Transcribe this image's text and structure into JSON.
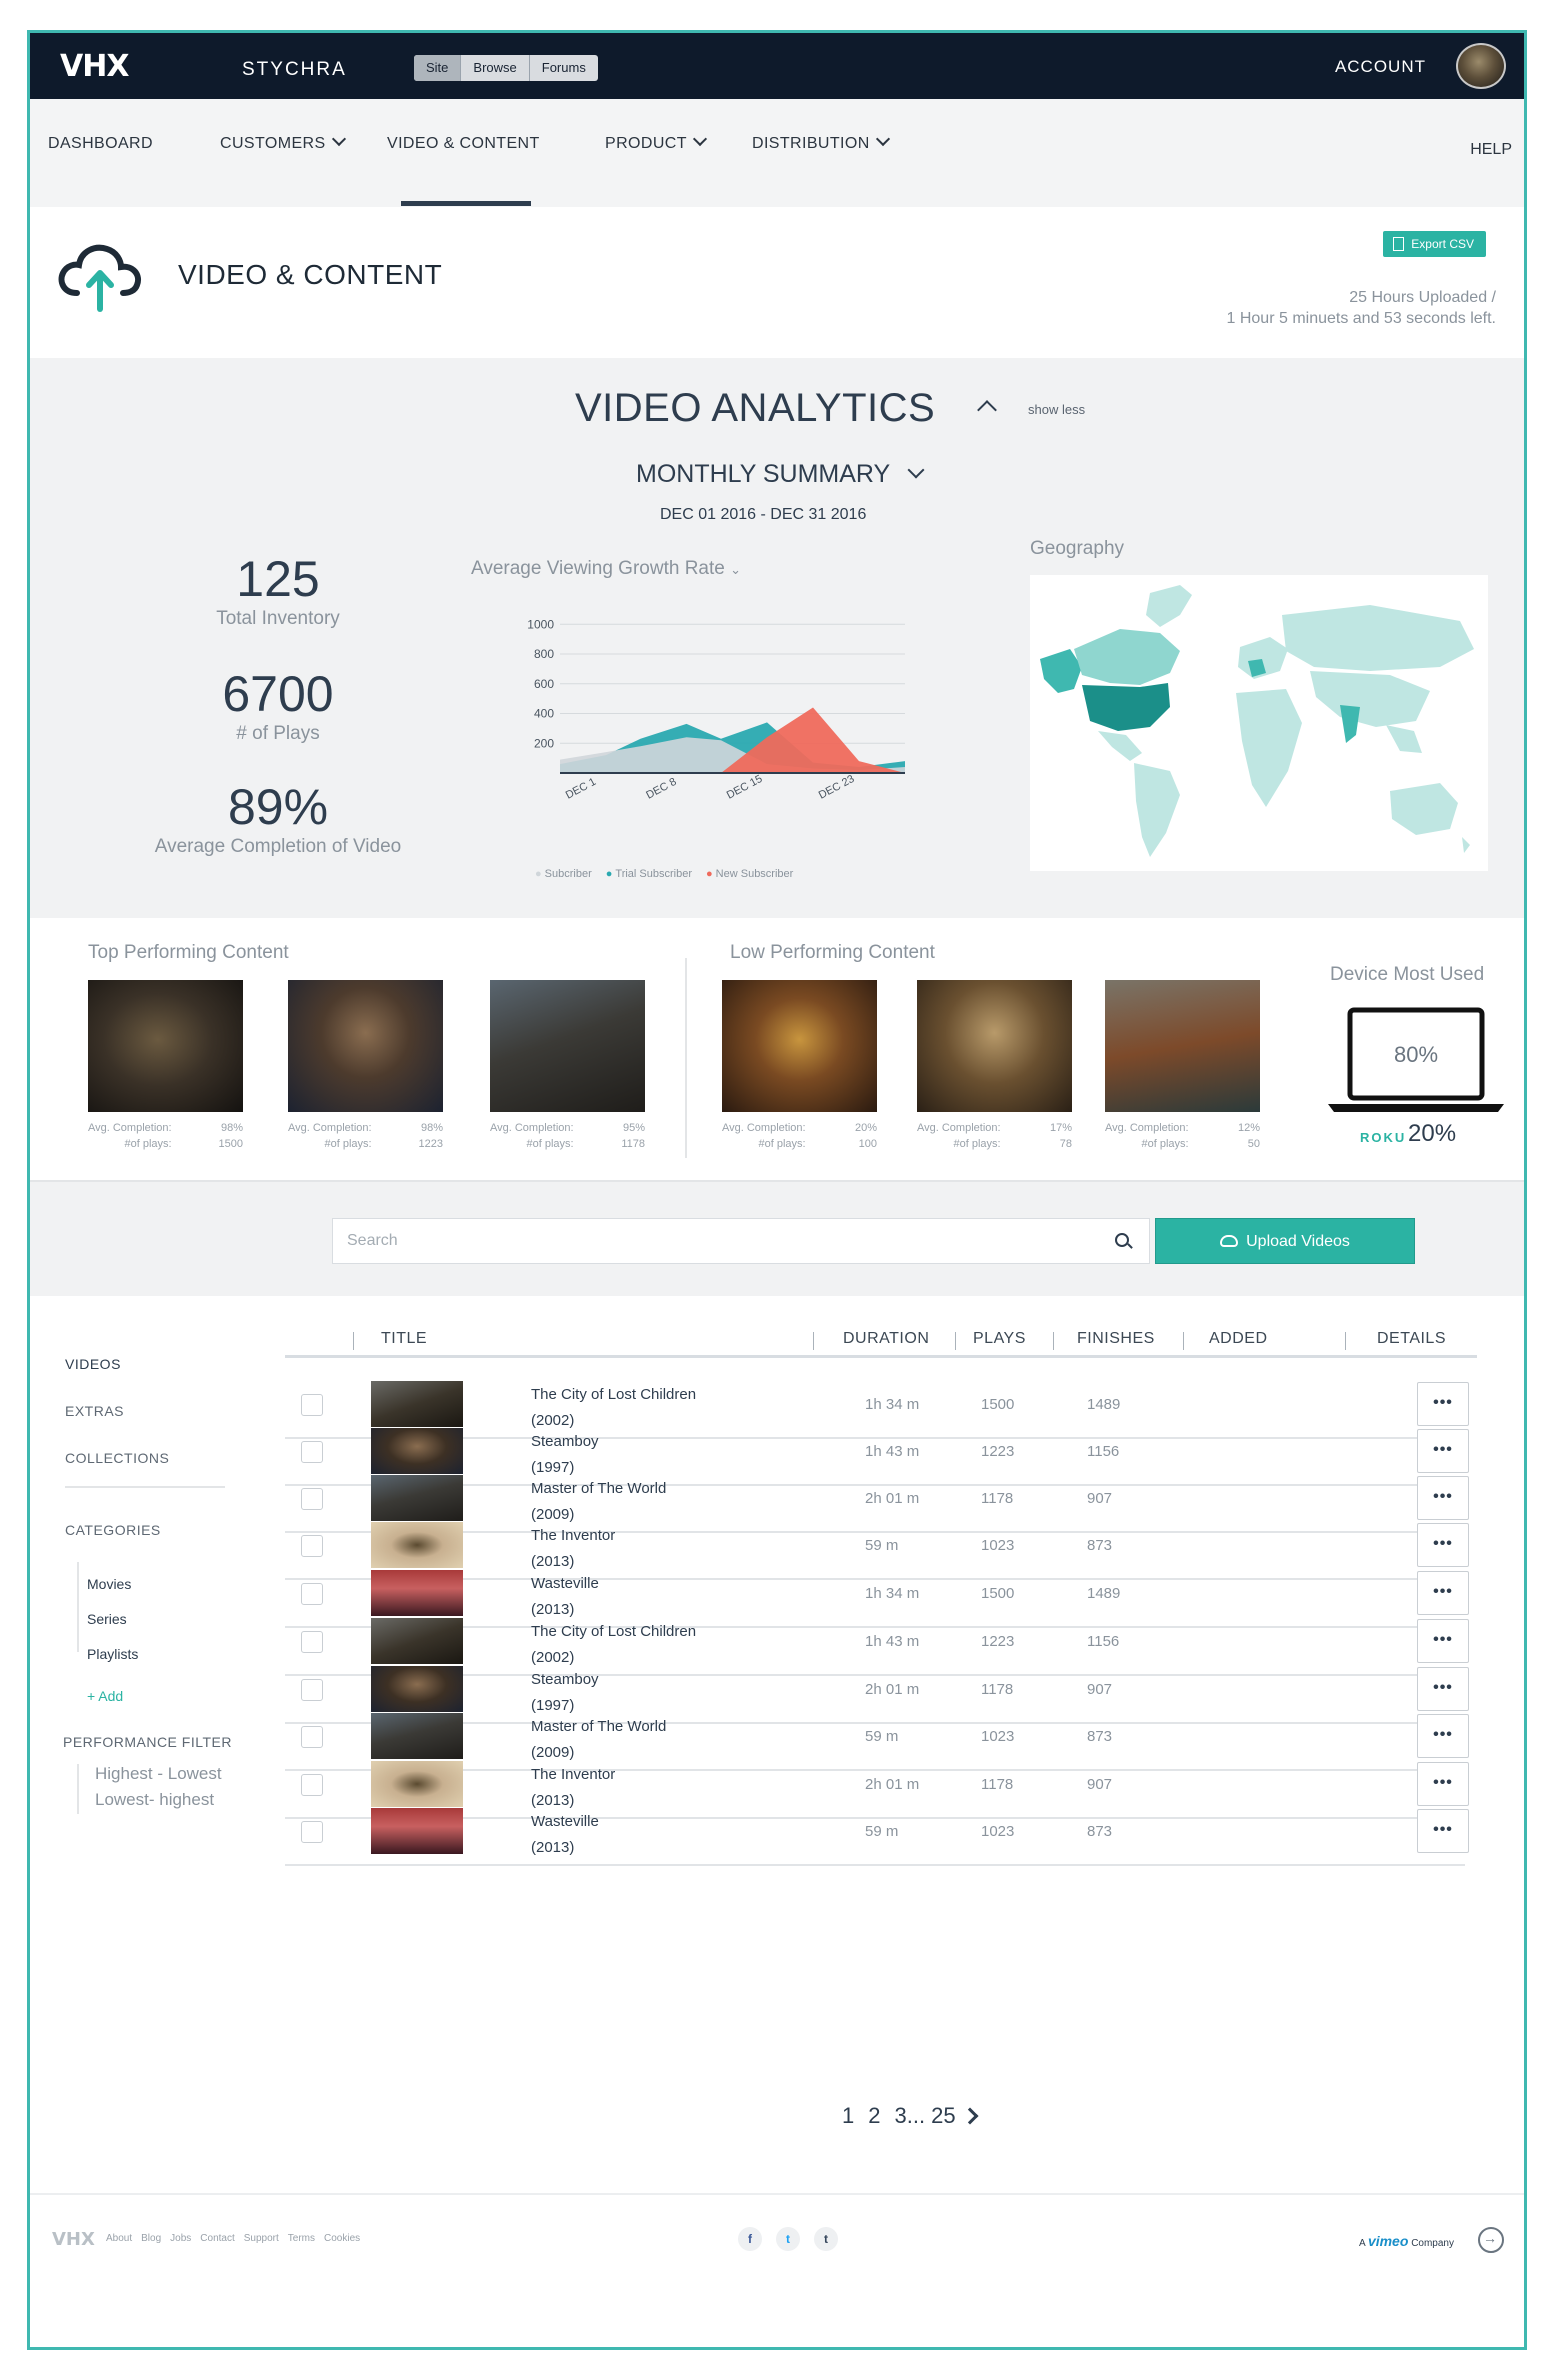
{
  "topbar": {
    "logo": "VHX",
    "site_name": "STYCHRA",
    "switcher": [
      "Site",
      "Browse",
      "Forums"
    ],
    "account": "ACCOUNT"
  },
  "nav": {
    "items": [
      {
        "label": "DASHBOARD"
      },
      {
        "label": "CUSTOMERS"
      },
      {
        "label": "VIDEO & CONTENT"
      },
      {
        "label": "PRODUCT"
      },
      {
        "label": "DISTRIBUTION"
      }
    ],
    "help": "HELP"
  },
  "header": {
    "title": "VIDEO & CONTENT",
    "export": "Export CSV",
    "upload_line1": "25 Hours Uploaded /",
    "upload_line2": "1 Hour  5 minuets and 53 seconds left."
  },
  "analytics": {
    "title": "VIDEO ANALYTICS",
    "show_less": "show less",
    "summary": "MONTHLY SUMMARY",
    "range": "DEC 01 2016 - DEC 31 2016",
    "stats": [
      {
        "value": "125",
        "label": "Total Inventory"
      },
      {
        "value": "6700",
        "label": "# of Plays"
      },
      {
        "value": "89%",
        "label": "Average Completion of Video"
      }
    ],
    "chart_title": "Average Viewing Growth Rate",
    "geo_title": "Geography"
  },
  "chart_data": {
    "type": "area",
    "title": "Average Viewing Growth Rate",
    "xlabel": "",
    "ylabel": "",
    "ylim": [
      0,
      1000
    ],
    "yticks": [
      1000,
      800,
      600,
      400,
      200
    ],
    "categories": [
      "DEC 1",
      "DEC 8",
      "DEC 15",
      "DEC 23"
    ],
    "x": [
      1,
      5,
      8,
      12,
      15,
      19,
      23,
      27,
      31
    ],
    "series": [
      {
        "name": "Subcriber",
        "color": "#d0d6da",
        "values": [
          90,
          140,
          180,
          240,
          220,
          60,
          30,
          20,
          40
        ]
      },
      {
        "name": "Trial Subscriber",
        "color": "#2aa9b0",
        "values": [
          60,
          120,
          230,
          330,
          230,
          340,
          70,
          40,
          80
        ]
      },
      {
        "name": "New Subscriber",
        "color": "#ef6a5c",
        "values": [
          0,
          0,
          0,
          0,
          0,
          240,
          440,
          80,
          0
        ]
      }
    ]
  },
  "top_performing": {
    "title": "Top Performing Content",
    "items": [
      {
        "completion": "98%",
        "plays": "1500"
      },
      {
        "completion": "98%",
        "plays": "1223"
      },
      {
        "completion": "95%",
        "plays": "1178"
      }
    ]
  },
  "low_performing": {
    "title": "Low Performing Content",
    "items": [
      {
        "completion": "20%",
        "plays": "100"
      },
      {
        "completion": "17%",
        "plays": "78"
      },
      {
        "completion": "12%",
        "plays": "50"
      }
    ]
  },
  "tile_labels": {
    "completion": "Avg. Completion:",
    "plays": "#of plays:"
  },
  "device": {
    "title": "Device Most Used",
    "laptop_pct": "80%",
    "roku": "ROKU",
    "roku_pct": "20%"
  },
  "search": {
    "placeholder": "Search",
    "upload": "Upload Videos"
  },
  "sidebar": {
    "videos": "VIDEOS",
    "extras": "EXTRAS",
    "collections": "COLLECTIONS",
    "categories": "CATEGORIES",
    "category_items": [
      "Movies",
      "Series",
      "Playlists"
    ],
    "add": "+ Add",
    "performance": "PERFORMANCE FILTER",
    "filters": [
      "Highest - Lowest",
      "Lowest- highest"
    ]
  },
  "table": {
    "headers": {
      "title": "TITLE",
      "duration": "DURATION",
      "plays": "PLAYS",
      "finishes": "FINISHES",
      "added": "ADDED",
      "details": "DETAILS"
    },
    "rows": [
      {
        "title": "The City of Lost Children",
        "year": "(2002)",
        "duration": "1h 34 m",
        "plays": "1500",
        "finishes": "1489",
        "thumb": "a"
      },
      {
        "title": "Steamboy",
        "year": "(1997)",
        "duration": "1h 43 m",
        "plays": "1223",
        "finishes": "1156",
        "thumb": "b"
      },
      {
        "title": "Master of The World",
        "year": "(2009)",
        "duration": "2h 01 m",
        "plays": "1178",
        "finishes": "907",
        "thumb": "c"
      },
      {
        "title": "The Inventor",
        "year": "(2013)",
        "duration": "59 m",
        "plays": "1023",
        "finishes": "873",
        "thumb": "d"
      },
      {
        "title": "Wasteville",
        "year": "(2013)",
        "duration": "1h 34 m",
        "plays": "1500",
        "finishes": "1489",
        "thumb": "e"
      },
      {
        "title": "The City of Lost Children",
        "year": "(2002)",
        "duration": "1h 43 m",
        "plays": "1223",
        "finishes": "1156",
        "thumb": "a"
      },
      {
        "title": "Steamboy",
        "year": "(1997)",
        "duration": "2h 01 m",
        "plays": "1178",
        "finishes": "907",
        "thumb": "b"
      },
      {
        "title": "Master of The World",
        "year": "(2009)",
        "duration": "59 m",
        "plays": "1023",
        "finishes": "873",
        "thumb": "c"
      },
      {
        "title": "The Inventor",
        "year": "(2013)",
        "duration": "2h 01 m",
        "plays": "1178",
        "finishes": "907",
        "thumb": "d"
      },
      {
        "title": "Wasteville",
        "year": "(2013)",
        "duration": "59 m",
        "plays": "1023",
        "finishes": "873",
        "thumb": "e"
      }
    ],
    "details_glyph": "•••"
  },
  "pagination": {
    "p1": "1",
    "p2": "2",
    "p3": "3... 25"
  },
  "footer": {
    "logo": "VHX",
    "links": [
      "About",
      "Blog",
      "Jobs",
      "Contact",
      "Support",
      "Terms",
      "Cookies"
    ],
    "social": [
      "f",
      "t",
      "t"
    ],
    "vimeo_prefix": "A",
    "vimeo_brand": "vimeo",
    "vimeo_suffix": "Company"
  }
}
